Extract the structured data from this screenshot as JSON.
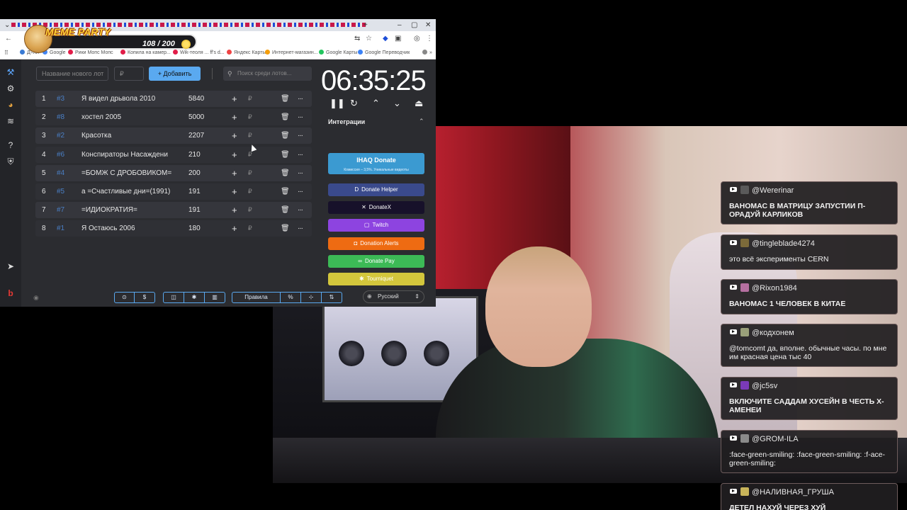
{
  "badge": {
    "title": "MEME PARTY",
    "count": "108 / 200"
  },
  "bookmarks": [
    {
      "label": "Д=лл",
      "color": "#3a7bd5"
    },
    {
      "label": "Google",
      "color": "#4285f4"
    },
    {
      "label": "Рики Мопс Мопс",
      "color": "#e11d48"
    },
    {
      "label": "Копила на камер...",
      "color": "#e11d48"
    },
    {
      "label": "Wik-теоля ... ff's d...",
      "color": "#e11d48"
    },
    {
      "label": "Яндекс Карты",
      "color": "#ef4444"
    },
    {
      "label": "Интернет-магазин...",
      "color": "#f59e0b"
    },
    {
      "label": "Google Карты",
      "color": "#22c55e"
    },
    {
      "label": "Google Переводчик",
      "color": "#3b82f6"
    }
  ],
  "toolbar": {
    "new_lot_placeholder": "Название нового лот",
    "amount_placeholder": "₽",
    "add_label": "+ Добавить",
    "search_placeholder": "Поиск среди лотов..."
  },
  "lots": [
    {
      "num": "1",
      "id": "#3",
      "name": "Я видел дрьвола 2010",
      "amount": "5840"
    },
    {
      "num": "2",
      "id": "#8",
      "name": "хостел 2005",
      "amount": "5000"
    },
    {
      "num": "3",
      "id": "#2",
      "name": "Красотка",
      "amount": "2207"
    },
    {
      "num": "4",
      "id": "#6",
      "name": "Конспираторы Насаждени",
      "amount": "210"
    },
    {
      "num": "5",
      "id": "#4",
      "name": "=БОМЖ С ДРОБОВИКОМ=",
      "amount": "200"
    },
    {
      "num": "6",
      "id": "#5",
      "name": "а =Счастливые дни=(1991)",
      "amount": "191"
    },
    {
      "num": "7",
      "id": "#7",
      "name": "=ИДИОКРАТИЯ=",
      "amount": "191"
    },
    {
      "num": "8",
      "id": "#1",
      "name": "Я Остаюсь 2006",
      "amount": "180"
    }
  ],
  "lot_symbols": {
    "plus": "+",
    "rub": "₽",
    "trash": "🗑",
    "more": "···"
  },
  "timer": "06:35:25",
  "integrations": {
    "title": "Интеграции",
    "ihaq": {
      "label": "IHAQ Donate",
      "sub": "Комиссия – 3,5%. Уникальные видеоты"
    },
    "buttons": [
      {
        "label": "Donate Helper",
        "color": "#3a4a8c"
      },
      {
        "label": "DonateX",
        "color": "#17112a"
      },
      {
        "label": "Twitch",
        "color": "#8d44e0"
      },
      {
        "label": "Donation Alerts",
        "color": "#ee6b12"
      },
      {
        "label": "Donate Pay",
        "color": "#3cba56"
      },
      {
        "label": "Tourniquet",
        "color": "#d3c63c"
      }
    ]
  },
  "bottom": {
    "rules_label": "Правила",
    "percent": "%",
    "language": "Русский"
  },
  "chat": [
    {
      "user": "@Wererinar",
      "avatar": "#5a5a5a",
      "text": "ВАНОМАС В МАТРИЦУ ЗАПУСТИИ П-ОРАДУЙ КАРЛИКОВ",
      "bold": true
    },
    {
      "user": "@tingleblade4274",
      "avatar": "#7c6a3a",
      "text": "это всё эксперименты CERN",
      "bold": false
    },
    {
      "user": "@Rixon1984",
      "avatar": "#b56fa0",
      "text": "ВАНОМАС 1 ЧЕЛОВЕК В КИТАЕ",
      "bold": true
    },
    {
      "user": "@кодхонем",
      "avatar": "#9aa07a",
      "text": "@tomcomt да, вполне. обычные часы. по мне им красная цена тыс 40",
      "bold": false
    },
    {
      "user": "@jc5sv",
      "avatar": "#7a3ab8",
      "text": "ВКЛЮЧИТЕ САДДАМ ХУСЕЙН В ЧЕСТЬ Х-АМЕНЕИ",
      "bold": true
    },
    {
      "user": "@GROM-ILA",
      "avatar": "#8a8a8a",
      "text": ":face-green-smiling: :face-green-smiling: :f-ace-green-smiling:",
      "bold": false
    },
    {
      "user": "@НАЛИВНАЯ_ГРУША",
      "avatar": "#c8b45a",
      "text": "ДЕТЕЛ НАХУЙ ЧЕРЕЗ ХУЙ",
      "bold": true
    }
  ]
}
